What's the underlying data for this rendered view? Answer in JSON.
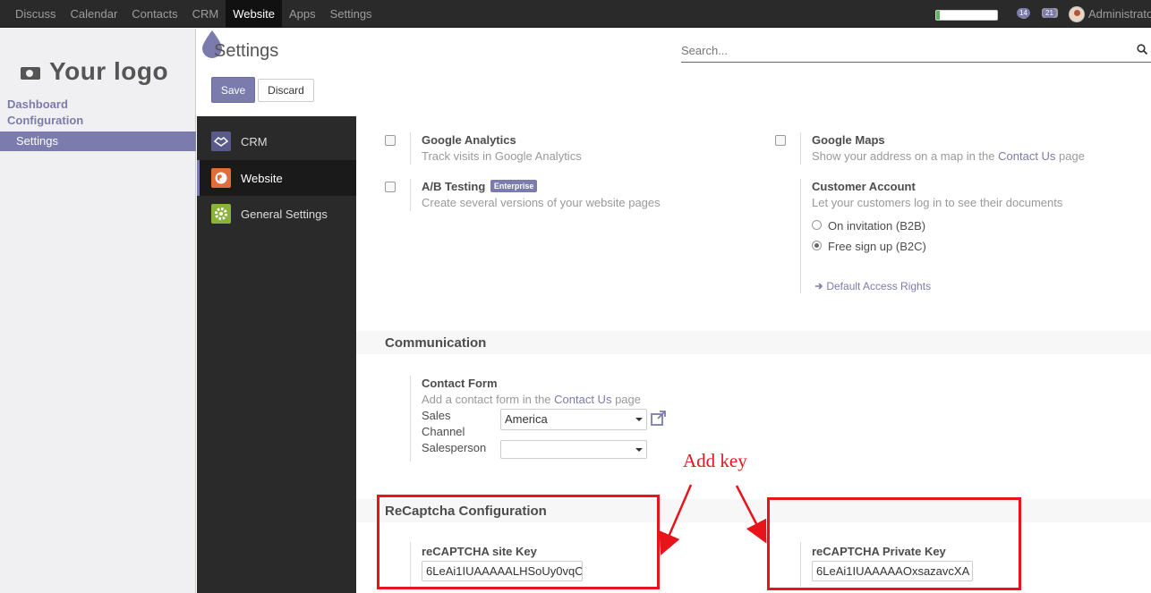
{
  "topbar": {
    "menu": [
      "Discuss",
      "Calendar",
      "Contacts",
      "CRM",
      "Website",
      "Apps",
      "Settings"
    ],
    "active_index": 4,
    "progress_fraction": 0.06,
    "messages_count": "14",
    "activities_count": "21",
    "user_name": "Administrator"
  },
  "sidebar": {
    "logo_text": "Your logo",
    "links": [
      "Dashboard",
      "Configuration"
    ],
    "active_item": "Settings"
  },
  "control_panel": {
    "title": "Settings",
    "search_placeholder": "Search...",
    "save_label": "Save",
    "discard_label": "Discard"
  },
  "apps": [
    {
      "label": "CRM",
      "icon": "handshake-icon",
      "color": "#5a5a8a"
    },
    {
      "label": "Website",
      "icon": "globe-icon",
      "color": "#e06d3c"
    },
    {
      "label": "General Settings",
      "icon": "gear-icon",
      "color": "#8bb33c"
    }
  ],
  "settings": {
    "google_analytics": {
      "title": "Google Analytics",
      "desc": "Track visits in Google Analytics"
    },
    "google_maps": {
      "title": "Google Maps",
      "desc_pre": "Show your address on a map in the ",
      "desc_link": "Contact Us",
      "desc_post": " page"
    },
    "ab_testing": {
      "title": "A/B Testing",
      "badge": "Enterprise",
      "desc": "Create several versions of your website pages"
    },
    "customer_account": {
      "title": "Customer Account",
      "desc": "Let your customers log in to see their documents",
      "options": [
        "On invitation (B2B)",
        "Free sign up (B2C)"
      ],
      "selected": "Free sign up (B2C)",
      "link": "Default Access Rights"
    },
    "communication": {
      "heading": "Communication",
      "contact_form_title": "Contact Form",
      "desc_pre": "Add a contact form in the ",
      "desc_link": "Contact Us",
      "desc_post": " page",
      "sales_channel_label_1": "Sales",
      "sales_channel_label_2": "Channel",
      "sales_channel_value": "America",
      "salesperson_label": "Salesperson",
      "salesperson_value": ""
    },
    "recaptcha": {
      "heading": "ReCaptcha Configuration",
      "site_key_label": "reCAPTCHA site Key",
      "site_key_value": "6LeAi1IUAAAAALHSoUy0vqC",
      "private_key_label": "reCAPTCHA Private Key",
      "private_key_value": "6LeAi1IUAAAAAOxsazavcXA"
    }
  },
  "annotation": {
    "text": "Add key",
    "color": "#e8141c"
  }
}
